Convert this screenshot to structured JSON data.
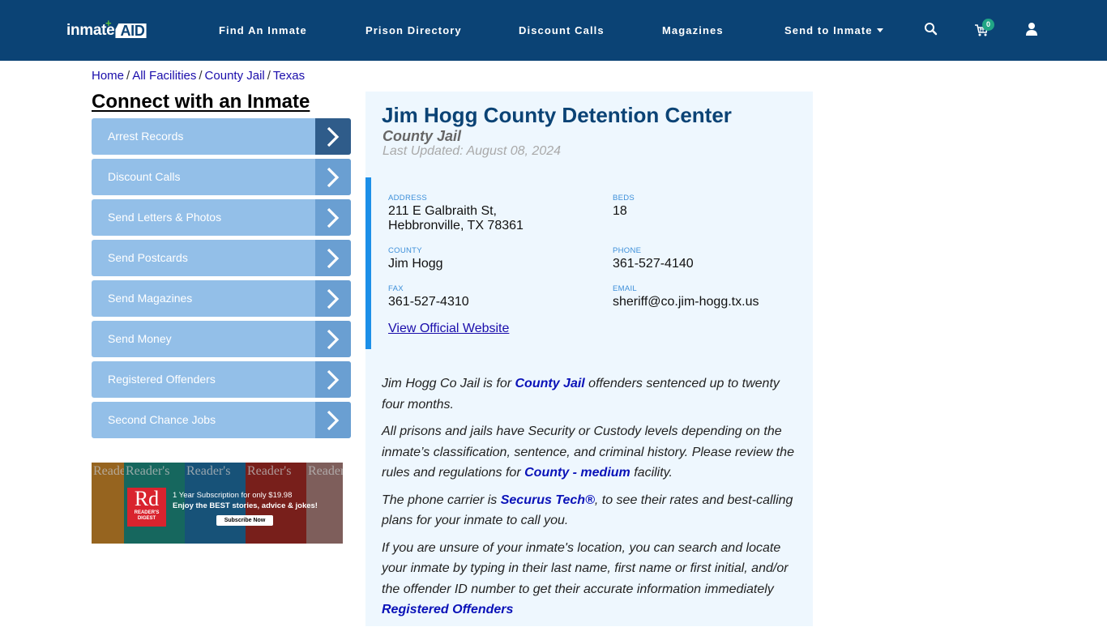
{
  "header": {
    "logo_text": "inmate",
    "logo_accent": "AID",
    "nav": [
      {
        "label": "Find An Inmate"
      },
      {
        "label": "Prison Directory"
      },
      {
        "label": "Discount Calls"
      },
      {
        "label": "Magazines"
      },
      {
        "label": "Send to Inmate",
        "has_dropdown": true
      }
    ],
    "icons": [
      "search-icon",
      "cart-icon",
      "user-icon"
    ],
    "cart_count": "0"
  },
  "breadcrumb": [
    "Home",
    "All Facilities",
    "County Jail",
    "Texas"
  ],
  "sidebar": {
    "title": "Connect with an Inmate",
    "items": [
      {
        "label": "Arrest Records",
        "active": true
      },
      {
        "label": "Discount Calls"
      },
      {
        "label": "Send Letters & Photos"
      },
      {
        "label": "Send Postcards"
      },
      {
        "label": "Send Magazines"
      },
      {
        "label": "Send Money"
      },
      {
        "label": "Registered Offenders"
      },
      {
        "label": "Second Chance Jobs"
      }
    ],
    "ad": {
      "brand_short": "Rd",
      "brand_name": "READER'S DIGEST",
      "cover_text": "Reader's",
      "line1": "1 Year Subscription for only $19.98",
      "line2": "Enjoy the BEST stories, advice & jokes!",
      "cta": "Subscribe Now"
    }
  },
  "facility": {
    "name": "Jim Hogg County Detention Center",
    "type": "County Jail",
    "last_updated": "Last Updated: August 08, 2024",
    "fields": {
      "address_label": "ADDRESS",
      "address_line1": "211 E Galbraith St,",
      "address_line2": "Hebbronville, TX 78361",
      "beds_label": "BEDS",
      "beds": "18",
      "county_label": "COUNTY",
      "county": "Jim Hogg",
      "phone_label": "PHONE",
      "phone": "361-527-4140",
      "fax_label": "FAX",
      "fax": "361-527-4310",
      "email_label": "EMAIL",
      "email": "sheriff@co.jim-hogg.tx.us"
    },
    "website_link": "View Official Website"
  },
  "description": {
    "p1_a": "Jim Hogg Co Jail is for ",
    "p1_link": "County Jail",
    "p1_b": " offenders sentenced up to twenty four months.",
    "p2_a": "All prisons and jails have Security or Custody levels depending on the inmate’s classification, sentence, and criminal history. Please review the rules and regulations for ",
    "p2_link": "County - medium",
    "p2_b": " facility.",
    "p3_a": "The phone carrier is ",
    "p3_link": "Securus Tech®",
    "p3_b": ", to see their rates and best-calling plans for your inmate to call you.",
    "p4_a": "If you are unsure of your inmate's location, you can search and locate your inmate by typing in their last name, first name or first initial, and/or the offender ID number to get their accurate information immediately ",
    "p4_link": "Registered Offenders"
  },
  "colors": {
    "header_bg": "#0b4375",
    "menu_bg": "#93bfe8",
    "menu_arrow_bg": "#6a9fd2",
    "menu_arrow_active": "#2f5c8a",
    "panel_bg": "#eef7fe",
    "accent_bar": "#1c8fe8",
    "link": "#0a12b8",
    "badge": "#21a685"
  }
}
